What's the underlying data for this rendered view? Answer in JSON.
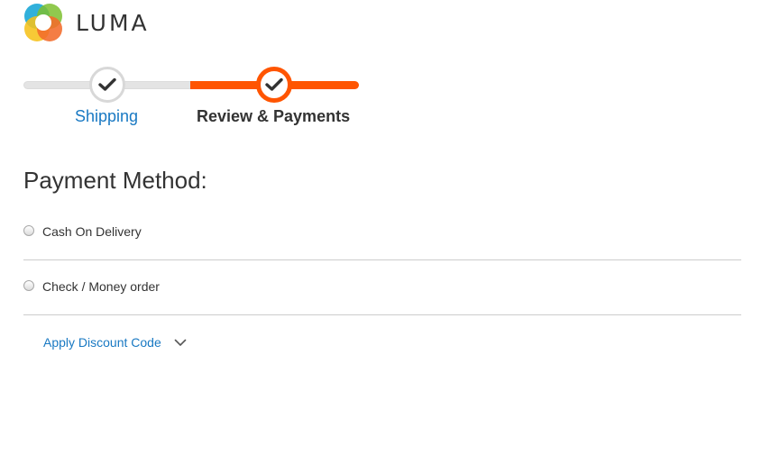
{
  "header": {
    "logo_text": "LUMA",
    "logo_icon": "luma-logo-icon"
  },
  "progress": {
    "steps": [
      {
        "label": "Shipping",
        "state": "complete",
        "icon": "check-icon"
      },
      {
        "label": "Review & Payments",
        "state": "active",
        "icon": "check-icon"
      }
    ],
    "active_color": "#ff5501",
    "inactive_color": "#e4e4e4",
    "link_color": "#1979c3"
  },
  "payment": {
    "title": "Payment Method:",
    "methods": [
      {
        "label": "Cash On Delivery",
        "selected": false
      },
      {
        "label": "Check / Money order",
        "selected": false
      }
    ]
  },
  "discount": {
    "label": "Apply Discount Code",
    "icon": "chevron-down-icon"
  }
}
